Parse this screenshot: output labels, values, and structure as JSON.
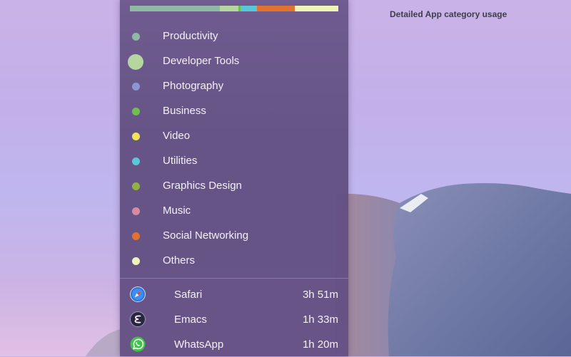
{
  "caption": "Detailed App category usage",
  "usage_bar": [
    {
      "color": "#8fb9a4",
      "share": 0.43
    },
    {
      "color": "#b5d69e",
      "share": 0.09
    },
    {
      "color": "#6fc04a",
      "share": 0.01
    },
    {
      "color": "#56c8d6",
      "share": 0.08
    },
    {
      "color": "#e0732f",
      "share": 0.18
    },
    {
      "color": "#eef5b6",
      "share": 0.21
    }
  ],
  "categories": [
    {
      "label": "Productivity",
      "color": "#8fb9a4",
      "icon": "dot-icon"
    },
    {
      "label": "Developer Tools",
      "color": "#b5d69e",
      "icon": "dot-icon"
    },
    {
      "label": "Photography",
      "color": "#8b98cf",
      "icon": "dot-icon"
    },
    {
      "label": "Business",
      "color": "#6fc04a",
      "icon": "dot-icon"
    },
    {
      "label": "Video",
      "color": "#f0e45a",
      "icon": "dot-icon"
    },
    {
      "label": "Utilities",
      "color": "#56c8d6",
      "icon": "dot-icon"
    },
    {
      "label": "Graphics Design",
      "color": "#92b13e",
      "icon": "dot-icon"
    },
    {
      "label": "Music",
      "color": "#d88ba0",
      "icon": "dot-icon"
    },
    {
      "label": "Social Networking",
      "color": "#e0732f",
      "icon": "dot-icon"
    },
    {
      "label": "Others",
      "color": "#eef5b6",
      "icon": "dot-icon"
    }
  ],
  "apps": [
    {
      "name": "Safari",
      "time": "3h 51m",
      "icon": "safari-icon"
    },
    {
      "name": "Emacs",
      "time": "1h 33m",
      "icon": "emacs-icon"
    },
    {
      "name": "WhatsApp",
      "time": "1h 20m",
      "icon": "whatsapp-icon"
    }
  ]
}
